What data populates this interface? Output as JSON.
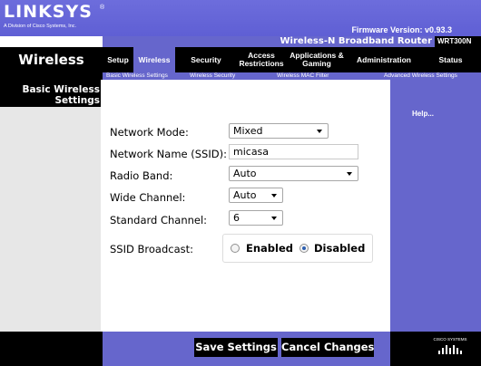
{
  "brand": {
    "logo": "LINKSYS",
    "reg": "®",
    "subtitle": "A Division of Cisco Systems, Inc.",
    "firmware": "Firmware Version: v0.93.3"
  },
  "product": {
    "name": "Wireless-N Broadband Router",
    "model": "WRT300N"
  },
  "section_title": "Wireless",
  "tabs": [
    {
      "label": "Setup",
      "active": false
    },
    {
      "label": "Wireless",
      "active": true
    },
    {
      "label": "Security",
      "active": false
    },
    {
      "label": "Access Restrictions",
      "active": false
    },
    {
      "label": "Applications & Gaming",
      "active": false
    },
    {
      "label": "Administration",
      "active": false
    },
    {
      "label": "Status",
      "active": false
    }
  ],
  "subtabs": [
    {
      "label": "Basic Wireless Settings",
      "active": true
    },
    {
      "label": "Wireless Security",
      "active": false
    },
    {
      "label": "Wireless MAC Filter",
      "active": false
    },
    {
      "label": "Advanced Wireless Settings",
      "active": false
    }
  ],
  "sidebar": {
    "heading": "Basic Wireless Settings"
  },
  "help": {
    "label": "Help..."
  },
  "form": {
    "network_mode": {
      "label": "Network Mode:",
      "value": "Mixed"
    },
    "ssid": {
      "label": "Network Name (SSID):",
      "value": "micasa"
    },
    "radio_band": {
      "label": "Radio Band:",
      "value": "Auto"
    },
    "wide_channel": {
      "label": "Wide Channel:",
      "value": "Auto"
    },
    "standard_channel": {
      "label": "Standard Channel:",
      "value": "6"
    },
    "ssid_broadcast": {
      "label": "SSID Broadcast:",
      "options": [
        {
          "label": "Enabled",
          "selected": false
        },
        {
          "label": "Disabled",
          "selected": true
        }
      ]
    }
  },
  "footer": {
    "save_label": "Save Settings",
    "cancel_label": "Cancel Changes",
    "cisco_text": "CISCO SYSTEMS"
  },
  "colors": {
    "accent": "#6666cc",
    "dark": "#000000",
    "sidebar_bg": "#e7e7e7"
  }
}
